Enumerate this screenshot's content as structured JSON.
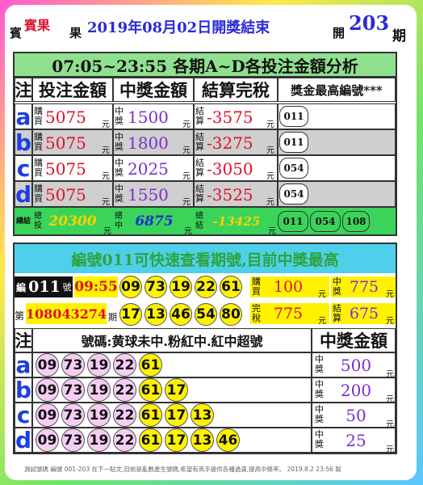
{
  "header": {
    "left_small": "賓",
    "brand": "賓果",
    "brand_suffix": "果",
    "date_text": "2019年08月02日開獎結束",
    "open_label": "開",
    "period_number": "203",
    "period_label": "期"
  },
  "table1": {
    "title": "07:05~23:55 各期A~D各投注金額分析",
    "headers": [
      "注",
      "投注金額",
      "中獎金額",
      "結算完稅",
      "獎金最高編號***"
    ],
    "buy_label": "購買",
    "win_label": "中獎",
    "settle_label": "結算",
    "unit": "元",
    "rows": [
      {
        "letter": "a",
        "bet": "5075",
        "win": "1500",
        "net": "-3575",
        "codes": [
          "011"
        ]
      },
      {
        "letter": "b",
        "bet": "5075",
        "win": "1800",
        "net": "-3275",
        "codes": [
          "011"
        ]
      },
      {
        "letter": "c",
        "bet": "5075",
        "win": "2025",
        "net": "-3050",
        "codes": [
          "054"
        ]
      },
      {
        "letter": "d",
        "bet": "5075",
        "win": "1550",
        "net": "-3525",
        "codes": [
          "054"
        ]
      }
    ],
    "summary": {
      "label": "總結",
      "bet_label": "總投",
      "bet": "20300",
      "win_label": "總中",
      "win": "6875",
      "net_label": "總結",
      "net": "-13425",
      "codes": [
        "011",
        "054",
        "108"
      ]
    }
  },
  "table2": {
    "title": "編號011可快速查看期號,目前中獎最高",
    "id_prefix": "編",
    "id": "011",
    "id_suffix": "號",
    "time": "09:55",
    "numbers_row1": [
      "09",
      "73",
      "19",
      "22",
      "61"
    ],
    "buy_label": "購買",
    "buy_value": "100",
    "win_label": "中獎",
    "win_value": "775",
    "draw_prefix": "第",
    "draw_no": "108043274",
    "draw_suffix": "期",
    "numbers_row2": [
      "17",
      "13",
      "46",
      "54",
      "80"
    ],
    "tax_label": "完稅",
    "tax_value": "775",
    "settle_label": "結算",
    "settle_value": "675",
    "unit": "元",
    "col_headers": [
      "注",
      "號碼:黄球未中.粉紅中.紅中超號",
      "中獎金額"
    ],
    "prize_label": "中獎",
    "rows": [
      {
        "letter": "a",
        "pink": [
          "09",
          "73",
          "19",
          "22"
        ],
        "yellow": [
          "61"
        ],
        "prize": "500"
      },
      {
        "letter": "b",
        "pink": [
          "09",
          "73",
          "19",
          "22"
        ],
        "yellow": [
          "61",
          "17"
        ],
        "prize": "200"
      },
      {
        "letter": "c",
        "pink": [
          "09",
          "73",
          "19",
          "22"
        ],
        "yellow": [
          "61",
          "17",
          "13"
        ],
        "prize": "50"
      },
      {
        "letter": "d",
        "pink": [
          "09",
          "73",
          "19",
          "22"
        ],
        "yellow": [
          "61",
          "17",
          "13",
          "46"
        ],
        "prize": "25"
      }
    ]
  },
  "footnote": "測試號碼 編號 001-203 在下一貼文,目前是亂數產生號碼,希望有高手提供各種過濾,提高中獎率。 2019.8.2 23:56 製",
  "colors": {
    "accent_blue": "#2b2bd6",
    "red": "#e0102a",
    "purple": "#7b2fd0",
    "green_row": "#3ad45a",
    "cyan_title": "#4fd0ea",
    "yellow": "#fff200",
    "pink": "#f6cdf5"
  }
}
